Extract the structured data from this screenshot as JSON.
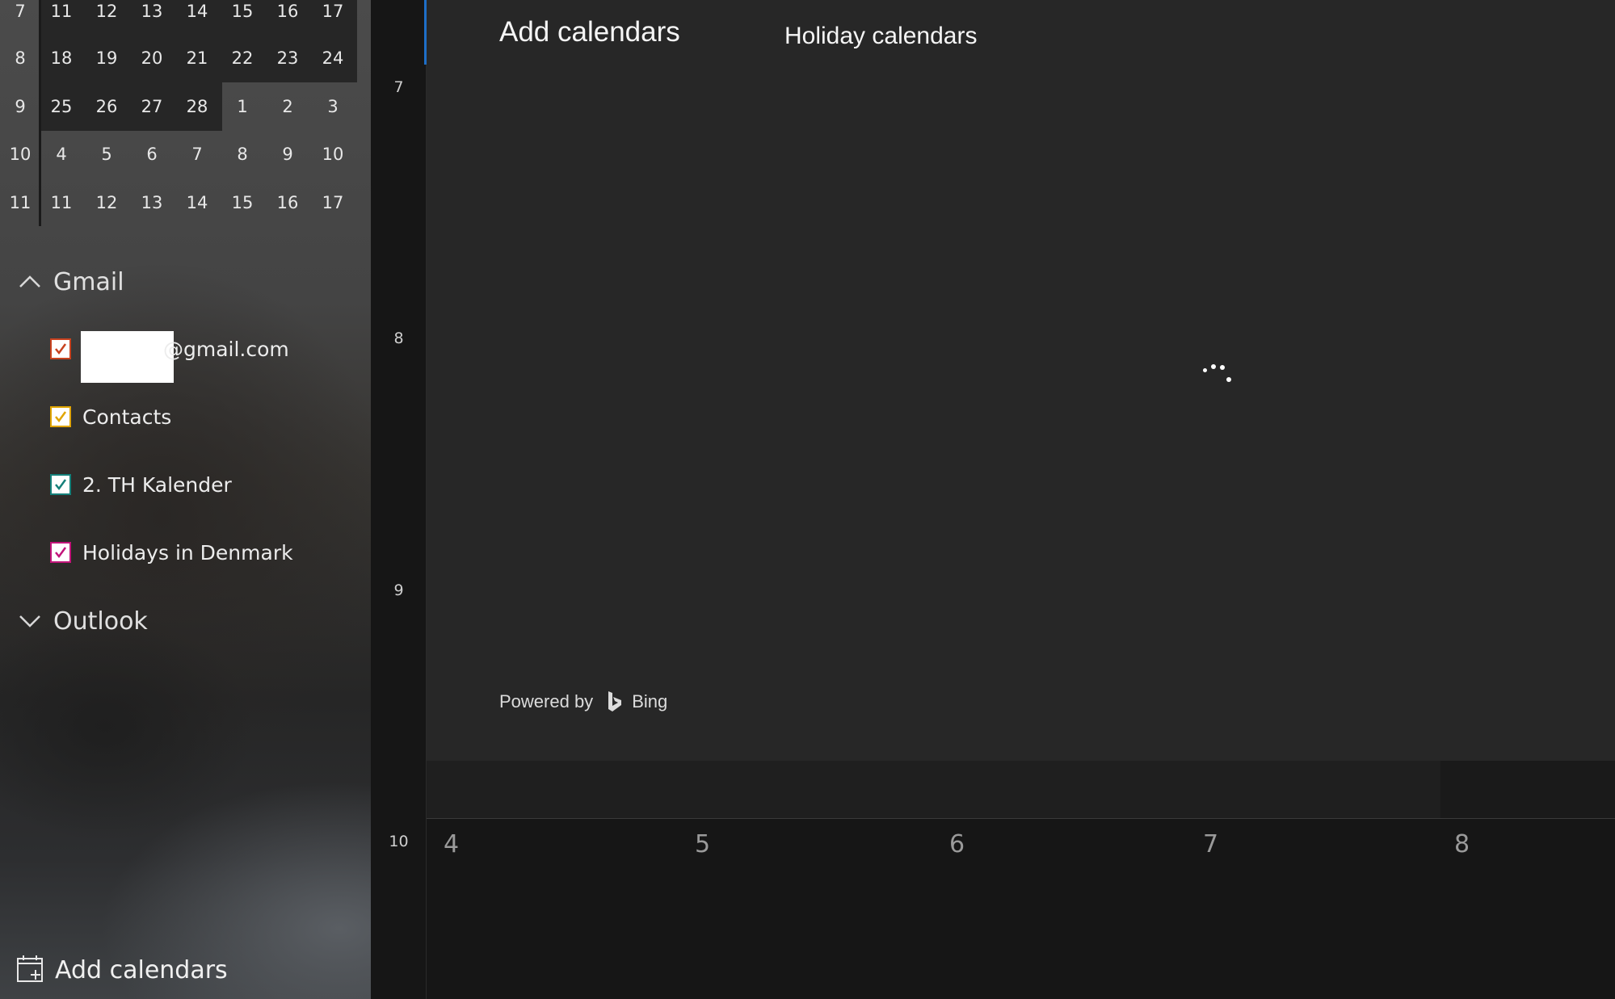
{
  "mini_calendar": {
    "weeks": [
      {
        "week": "7",
        "days": [
          "11",
          "12",
          "13",
          "14",
          "15",
          "16",
          "17"
        ]
      },
      {
        "week": "8",
        "days": [
          "18",
          "19",
          "20",
          "21",
          "22",
          "23",
          "24"
        ]
      },
      {
        "week": "9",
        "days": [
          "25",
          "26",
          "27",
          "28",
          "1",
          "2",
          "3"
        ]
      },
      {
        "week": "10",
        "days": [
          "4",
          "5",
          "6",
          "7",
          "8",
          "9",
          "10"
        ]
      },
      {
        "week": "11",
        "days": [
          "11",
          "12",
          "13",
          "14",
          "15",
          "16",
          "17"
        ]
      }
    ]
  },
  "accounts": {
    "gmail": {
      "name": "Gmail",
      "calendars": [
        {
          "label": "@gmail.com",
          "color": "#c8421f"
        },
        {
          "label": "Contacts",
          "color": "#e0a500"
        },
        {
          "label": "2. TH Kalender",
          "color": "#15807a"
        },
        {
          "label": "Holidays in Denmark",
          "color": "#c2157a"
        }
      ]
    },
    "outlook": {
      "name": "Outlook"
    }
  },
  "left_footer": {
    "add_calendars": "Add calendars"
  },
  "time_gutter": {
    "hours": [
      "7",
      "8",
      "9",
      "10"
    ]
  },
  "add_panel": {
    "title": "Add calendars",
    "subtitle": "Holiday calendars",
    "powered_by": "Powered by",
    "bing": "Bing"
  },
  "week_dates": [
    "4",
    "5",
    "6",
    "7",
    "8"
  ],
  "colors": {
    "accent": "#1e6fc8",
    "panel_bg": "#272727"
  }
}
